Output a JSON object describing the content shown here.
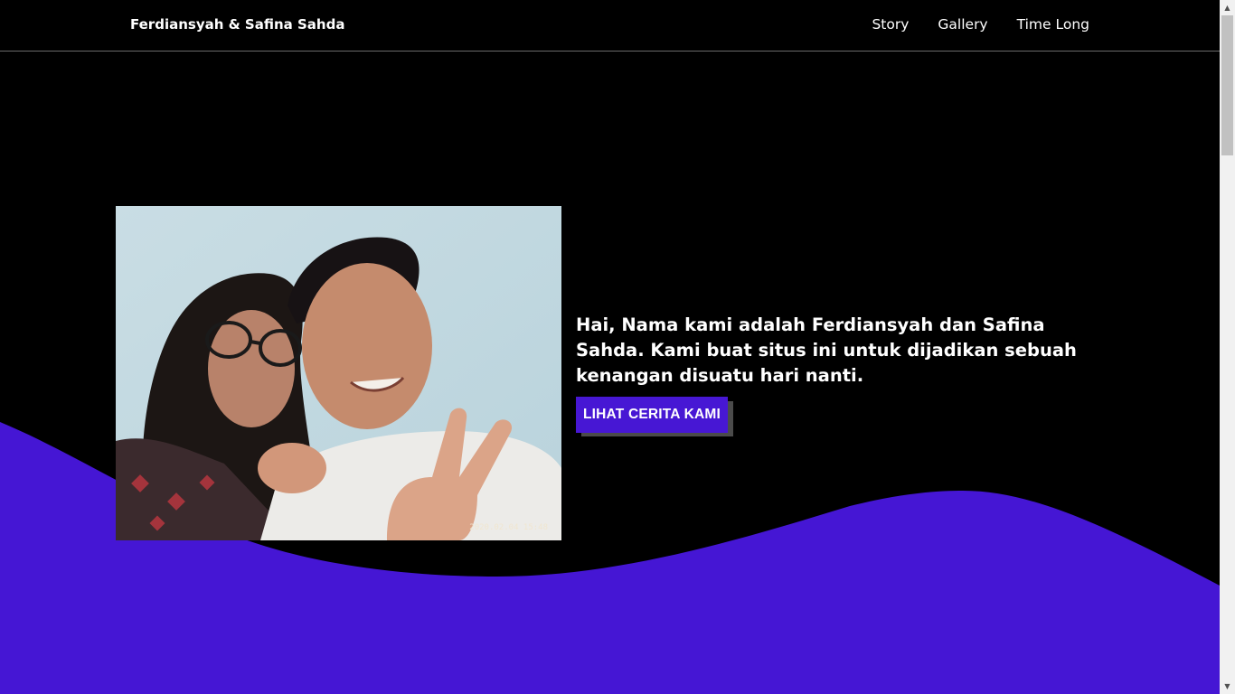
{
  "navbar": {
    "brand": "Ferdiansyah & Safina Sahda",
    "links": [
      {
        "label": "Story"
      },
      {
        "label": "Gallery"
      },
      {
        "label": "Time Long"
      }
    ]
  },
  "hero": {
    "photo_timestamp": "2020.02.04 15:48",
    "intro": "Hai, Nama kami adalah Ferdiansyah dan Safina Sahda. Kami buat situs ini untuk dijadikan sebuah kenangan disuatu hari nanti.",
    "cta_label": "LIHAT CERITA KAMI"
  },
  "colors": {
    "background": "#000000",
    "accent": "#4717d4",
    "text": "#ffffff"
  },
  "icons": {
    "scroll_up": "triangle-up-icon",
    "scroll_down": "triangle-down-icon"
  }
}
